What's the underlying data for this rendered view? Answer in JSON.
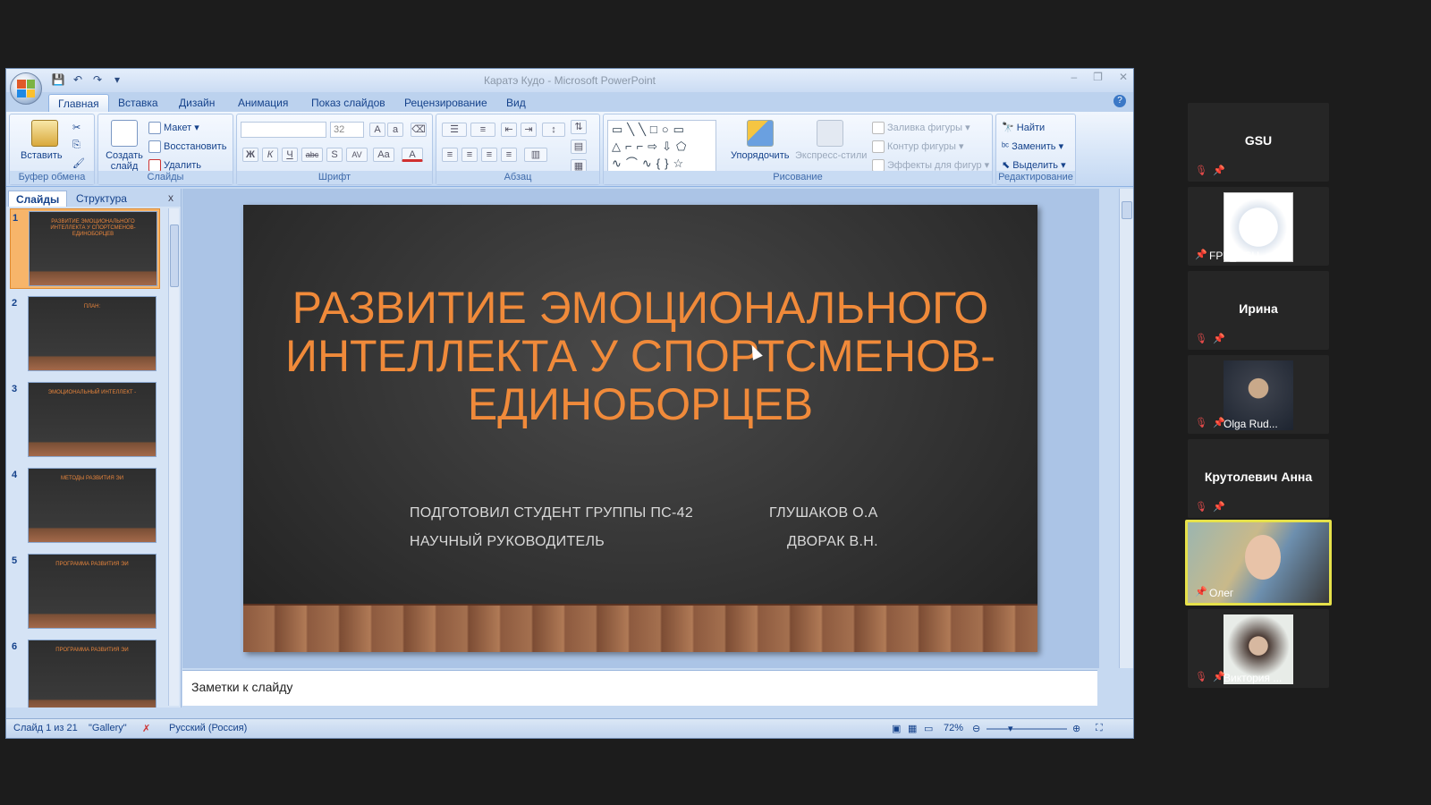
{
  "window": {
    "title": "Каратэ Кудо - Microsoft PowerPoint",
    "minimize": "–",
    "restore": "❐",
    "close": "✕"
  },
  "ribbon": {
    "tabs": [
      "Главная",
      "Вставка",
      "Дизайн",
      "Анимация",
      "Показ слайдов",
      "Рецензирование",
      "Вид"
    ],
    "active_tab": "Главная",
    "clipboard": {
      "label": "Буфер обмена",
      "paste": "Вставить"
    },
    "slides": {
      "label": "Слайды",
      "new_slide": "Создать слайд",
      "layout": "Макет",
      "reset": "Восстановить",
      "delete": "Удалить"
    },
    "font": {
      "label": "Шрифт",
      "size": "32",
      "bold": "Ж",
      "italic": "К",
      "underline": "Ч",
      "strike": "abc",
      "shadow": "S",
      "spacing": "AV",
      "case": "Aa",
      "color": "A"
    },
    "paragraph": {
      "label": "Абзац"
    },
    "drawing": {
      "label": "Рисование",
      "arrange": "Упорядочить",
      "quick_styles": "Экспресс-стили",
      "fill": "Заливка фигуры",
      "outline": "Контур фигуры",
      "effects": "Эффекты для фигур"
    },
    "editing": {
      "label": "Редактирование",
      "find": "Найти",
      "replace": "Заменить",
      "select": "Выделить"
    }
  },
  "left_panel": {
    "tabs": [
      "Слайды",
      "Структура"
    ],
    "close": "x",
    "thumbnails": [
      {
        "num": "1",
        "title": "РАЗВИТИЕ ЭМОЦИОНАЛЬНОГО ИНТЕЛЛЕКТА У СПОРТСМЕНОВ-ЕДИНОБОРЦЕВ",
        "body": ""
      },
      {
        "num": "2",
        "title": "ПЛАН:",
        "body": ""
      },
      {
        "num": "3",
        "title": "ЭМОЦИОНАЛЬНЫЙ ИНТЕЛЛЕКТ -",
        "body": ""
      },
      {
        "num": "4",
        "title": "МЕТОДЫ РАЗВИТИЯ ЭИ",
        "body": ""
      },
      {
        "num": "5",
        "title": "ПРОГРАММА РАЗВИТИЯ ЭИ",
        "body": ""
      },
      {
        "num": "6",
        "title": "ПРОГРАММА РАЗВИТИЯ ЭИ",
        "body": ""
      }
    ]
  },
  "slide": {
    "title": "РАЗВИТИЕ ЭМОЦИОНАЛЬНОГО ИНТЕЛЛЕКТА У СПОРТСМЕНОВ-ЕДИНОБОРЦЕВ",
    "line1_left": "ПОДГОТОВИЛ СТУДЕНТ ГРУППЫ ПС-42",
    "line1_right": "ГЛУШАКОВ О.А",
    "line2_left": "НАУЧНЫЙ РУКОВОДИТЕЛЬ",
    "line2_right": "ДВОРАК В.Н."
  },
  "notes_placeholder": "Заметки к слайду",
  "status": {
    "slide_counter": "Слайд 1 из 21",
    "theme": "\"Gallery\"",
    "language": "Русский (Россия)",
    "zoom": "72%"
  },
  "participants": [
    {
      "name": "GSU",
      "video": false,
      "muted": true
    },
    {
      "name": "FPP_GSU",
      "video": true,
      "muted": false
    },
    {
      "name": "Ирина",
      "video": false,
      "muted": true
    },
    {
      "name": "Olga Rud...",
      "video": true,
      "muted": true
    },
    {
      "name": "Крутолевич Анна",
      "video": false,
      "muted": true
    },
    {
      "name": "Олег",
      "video": true,
      "muted": false,
      "active": true
    },
    {
      "name": "Виктория ...",
      "video": true,
      "muted": true
    }
  ]
}
